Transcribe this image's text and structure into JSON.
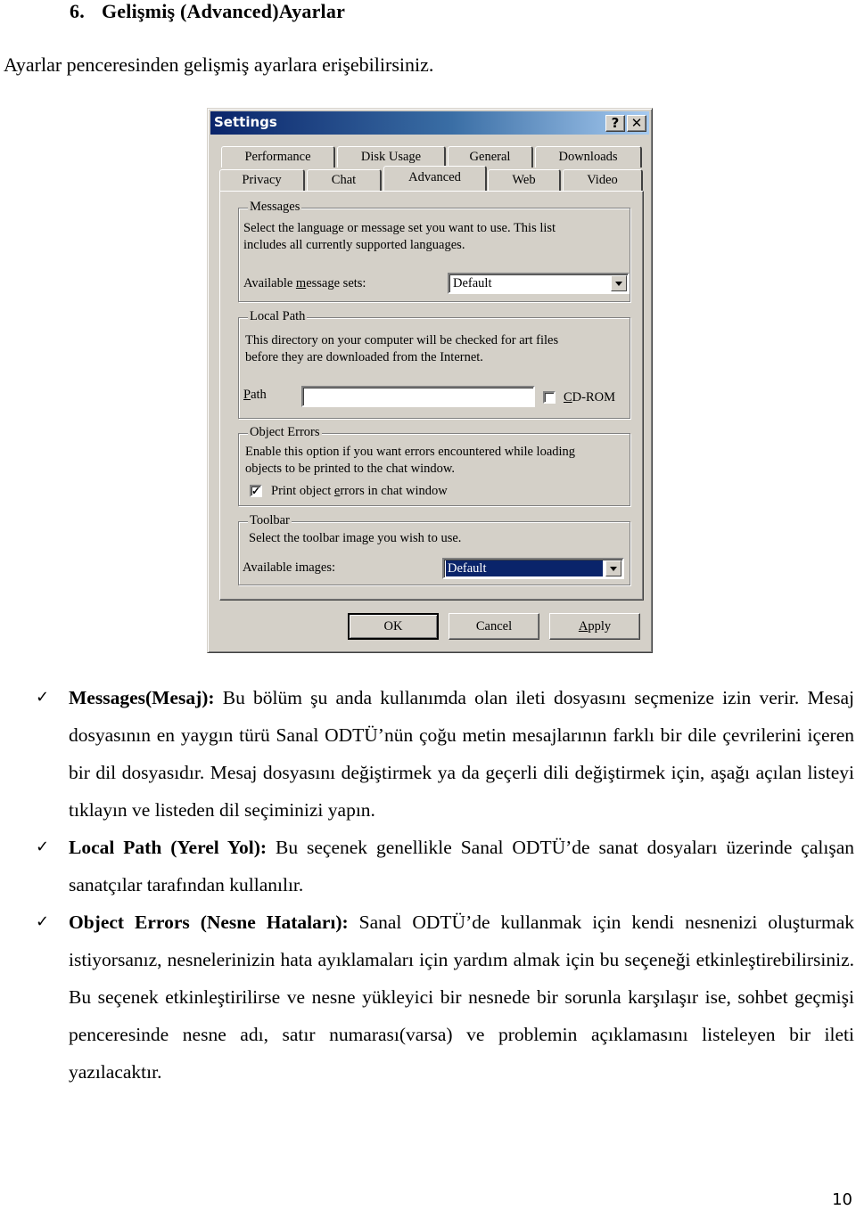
{
  "document": {
    "section_number": "6.",
    "section_title": "Gelişmiş (Advanced)Ayarlar",
    "intro": "Ayarlar penceresinden gelişmiş ayarlara erişebilirsiniz.",
    "page_number": "10"
  },
  "dialog": {
    "title": "Settings",
    "help_button": "?",
    "close_button": "✕",
    "tabs_row1": [
      "Performance",
      "Disk Usage",
      "General",
      "Downloads"
    ],
    "tabs_row2": [
      "Privacy",
      "Chat",
      "Advanced",
      "Web",
      "Video"
    ],
    "active_tab": "Advanced",
    "messages": {
      "legend": "Messages",
      "line1": "Select the language or message set you want to use.  This list",
      "line2": "includes all currently supported languages.",
      "label_pre": "Available ",
      "label_u": "m",
      "label_post": "essage sets:",
      "value": "Default"
    },
    "local_path": {
      "legend": "Local Path",
      "line1": "This directory on your computer will be checked for art files",
      "line2": "before they are downloaded from the Internet.",
      "path_label_u": "P",
      "path_label_rest": "ath",
      "path_value": "",
      "cdrom_u": "C",
      "cdrom_rest": "D-ROM",
      "cdrom_checked": false
    },
    "object_errors": {
      "legend": "Object Errors",
      "line1": "Enable this option if you want errors encountered while loading",
      "line2": "objects to be printed to the chat window.",
      "checkbox_pre": "Print object ",
      "checkbox_u": "e",
      "checkbox_post": "rrors in chat window",
      "checked": true,
      "check_glyph": "✓"
    },
    "toolbar": {
      "legend": "Toolbar",
      "line1": "Select the toolbar image you wish to use.",
      "label": "Available images:",
      "value": "Default"
    },
    "buttons": {
      "ok": "OK",
      "cancel": "Cancel",
      "apply_u": "A",
      "apply_rest": "pply"
    }
  },
  "bullets": [
    {
      "check": "✓",
      "bold": "Messages(Mesaj):",
      "text": " Bu bölüm şu anda kullanımda olan ileti dosyasını seçmenize izin verir. Mesaj dosyasının en yaygın türü Sanal ODTÜ’nün çoğu metin mesajlarının farklı bir dile çevrilerini içeren bir dil dosyasıdır. Mesaj dosyasını değiştirmek ya da geçerli dili değiştirmek için, aşağı açılan listeyi tıklayın ve listeden dil seçiminizi yapın."
    },
    {
      "check": "✓",
      "bold": "Local Path (Yerel Yol):",
      "text": " Bu seçenek genellikle Sanal ODTÜ’de sanat dosyaları üzerinde çalışan sanatçılar tarafından kullanılır."
    },
    {
      "check": "✓",
      "bold": "Object Errors (Nesne Hataları):",
      "text": " Sanal ODTÜ’de kullanmak için kendi nesnenizi oluşturmak istiyorsanız, nesnelerinizin hata ayıklamaları için yardım almak için bu seçeneği etkinleştirebilirsiniz. Bu seçenek etkinleştirilirse ve nesne yükleyici bir nesnede bir sorunla karşılaşır ise, sohbet geçmişi penceresinde nesne adı, satır numarası(varsa) ve problemin açıklamasını listeleyen bir ileti yazılacaktır."
    }
  ]
}
